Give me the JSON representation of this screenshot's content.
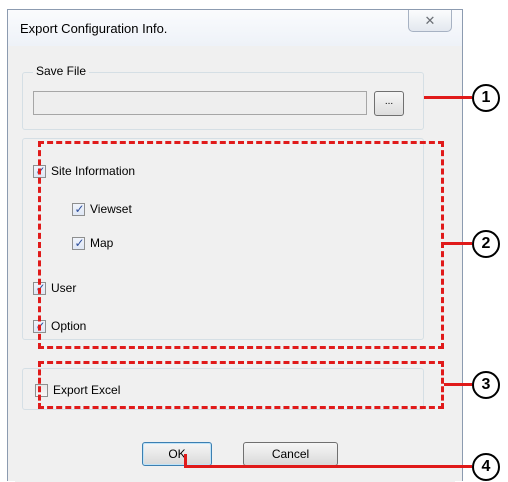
{
  "window": {
    "title": "Export Configuration Info.",
    "close_glyph": "✕"
  },
  "save_file": {
    "group_label": "Save File",
    "path_value": "",
    "browse_label": "..."
  },
  "options": {
    "site_information": {
      "label": "Site Information",
      "checked": true
    },
    "viewset": {
      "label": "Viewset",
      "checked": true
    },
    "map": {
      "label": "Map",
      "checked": true
    },
    "user": {
      "label": "User",
      "checked": true
    },
    "option": {
      "label": "Option",
      "checked": true
    },
    "export_excel": {
      "label": "Export Excel",
      "checked": false
    }
  },
  "buttons": {
    "ok_label": "OK",
    "cancel_label": "Cancel"
  },
  "callouts": [
    "1",
    "2",
    "3",
    "4"
  ],
  "colors": {
    "annotation_red": "#e01a1a",
    "checkmark": "#2f4f9c"
  }
}
